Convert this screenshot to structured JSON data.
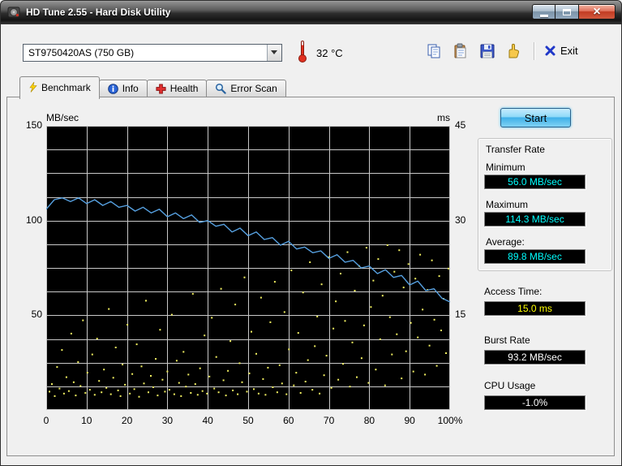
{
  "window": {
    "title": "HD Tune 2.55 - Hard Disk Utility",
    "controls": {
      "close_glyph": "×"
    }
  },
  "toolbar": {
    "drive": "ST9750420AS (750 GB)",
    "temperature": "32 °C",
    "exit_label": "Exit",
    "icons": [
      "copy-image",
      "copy-text",
      "save-screenshot",
      "options",
      "exit"
    ]
  },
  "tabs": [
    {
      "label": "Benchmark",
      "icon": "benchmark-icon",
      "active": true
    },
    {
      "label": "Info",
      "icon": "info-icon",
      "active": false
    },
    {
      "label": "Health",
      "icon": "health-icon",
      "active": false
    },
    {
      "label": "Error Scan",
      "icon": "error-scan-icon",
      "active": false
    }
  ],
  "side_panel": {
    "start_label": "Start",
    "transfer_rate": {
      "title": "Transfer Rate",
      "minimum_label": "Minimum",
      "minimum_value": "56.0 MB/sec",
      "maximum_label": "Maximum",
      "maximum_value": "114.3 MB/sec",
      "average_label": "Average:",
      "average_value": "89.8 MB/sec"
    },
    "access_time_label": "Access Time:",
    "access_time_value": "15.0 ms",
    "burst_rate_label": "Burst Rate",
    "burst_rate_value": "93.2 MB/sec",
    "cpu_usage_label": "CPU Usage",
    "cpu_usage_value": "-1.0%"
  },
  "colors": {
    "transfer_value_text": "#00ffff",
    "access_value_text": "#ffff00",
    "burst_value_text": "#ffffff",
    "cpu_value_text": "#ffffff",
    "chart_background": "#000000",
    "grid": "#c8c8c8",
    "transfer_line": "#56a0e0",
    "access_dots": "#f0ee60"
  },
  "chart_data": {
    "type": "line",
    "title": "",
    "left_axis": {
      "label": "MB/sec",
      "min": 0,
      "max": 150,
      "ticks": [
        150,
        100,
        50
      ]
    },
    "right_axis": {
      "label": "ms",
      "min": 0,
      "max": 45,
      "ticks": [
        45,
        30,
        15
      ]
    },
    "x_axis": {
      "min": 0,
      "max": 100,
      "tick_labels": [
        "0",
        "10",
        "20",
        "30",
        "40",
        "50",
        "60",
        "70",
        "80",
        "90",
        "100%"
      ]
    },
    "grid": {
      "x_divisions": 10,
      "y_divisions": 12,
      "color": "#c8c8c8"
    },
    "series": [
      {
        "name": "transfer_rate",
        "unit": "MB/sec",
        "color": "#56a0e0",
        "x_start": 0,
        "x_step": 2,
        "values": [
          106,
          111,
          112,
          110,
          112,
          109,
          111,
          108,
          110,
          107,
          108,
          105,
          107,
          104,
          106,
          102,
          104,
          101,
          103,
          99,
          100,
          97,
          98,
          94,
          96,
          92,
          94,
          90,
          91,
          87,
          89,
          85,
          86,
          83,
          84,
          80,
          82,
          78,
          79,
          75,
          76,
          72,
          74,
          70,
          71,
          66,
          68,
          63,
          64,
          59,
          57
        ]
      },
      {
        "name": "access_time_ms",
        "type": "scatter",
        "unit": "ms",
        "color": "#f0ee60",
        "points": [
          [
            0.8,
            2.9
          ],
          [
            1.4,
            4.1
          ],
          [
            2.1,
            2.2
          ],
          [
            2.7,
            6.8
          ],
          [
            3.3,
            3.4
          ],
          [
            3.9,
            9.5
          ],
          [
            4.4,
            2.6
          ],
          [
            5.0,
            5.2
          ],
          [
            5.6,
            3.0
          ],
          [
            6.2,
            12.1
          ],
          [
            6.8,
            4.4
          ],
          [
            7.3,
            2.3
          ],
          [
            7.9,
            7.6
          ],
          [
            8.5,
            3.8
          ],
          [
            9.1,
            14.2
          ],
          [
            9.7,
            2.7
          ],
          [
            10.2,
            5.9
          ],
          [
            10.8,
            3.2
          ],
          [
            11.4,
            8.8
          ],
          [
            12.0,
            2.4
          ],
          [
            12.6,
            11.3
          ],
          [
            13.1,
            4.6
          ],
          [
            13.7,
            2.8
          ],
          [
            14.3,
            6.4
          ],
          [
            14.9,
            3.5
          ],
          [
            15.5,
            16.0
          ],
          [
            16.0,
            2.5
          ],
          [
            16.6,
            5.1
          ],
          [
            17.2,
            9.9
          ],
          [
            17.8,
            3.1
          ],
          [
            18.4,
            2.2
          ],
          [
            18.9,
            7.2
          ],
          [
            19.5,
            4.0
          ],
          [
            20.1,
            13.5
          ],
          [
            20.7,
            2.6
          ],
          [
            21.3,
            5.7
          ],
          [
            21.8,
            3.3
          ],
          [
            22.4,
            10.4
          ],
          [
            23.0,
            2.1
          ],
          [
            23.6,
            6.9
          ],
          [
            24.2,
            4.2
          ],
          [
            24.7,
            17.3
          ],
          [
            25.3,
            2.8
          ],
          [
            25.9,
            5.4
          ],
          [
            26.5,
            3.6
          ],
          [
            27.1,
            8.1
          ],
          [
            27.6,
            2.3
          ],
          [
            28.2,
            12.7
          ],
          [
            28.8,
            4.8
          ],
          [
            29.4,
            2.9
          ],
          [
            30.0,
            6.1
          ],
          [
            30.5,
            3.2
          ],
          [
            31.1,
            15.1
          ],
          [
            31.7,
            2.5
          ],
          [
            32.3,
            7.8
          ],
          [
            32.9,
            4.3
          ],
          [
            33.4,
            2.2
          ],
          [
            34.0,
            9.2
          ],
          [
            34.6,
            3.7
          ],
          [
            35.2,
            5.6
          ],
          [
            35.8,
            2.7
          ],
          [
            36.3,
            18.4
          ],
          [
            36.9,
            4.1
          ],
          [
            37.5,
            2.4
          ],
          [
            38.1,
            6.6
          ],
          [
            38.7,
            3.0
          ],
          [
            39.2,
            11.8
          ],
          [
            39.8,
            2.6
          ],
          [
            40.4,
            5.3
          ],
          [
            41.0,
            14.6
          ],
          [
            41.6,
            3.4
          ],
          [
            42.1,
            8.4
          ],
          [
            42.7,
            2.8
          ],
          [
            43.3,
            19.2
          ],
          [
            43.9,
            4.7
          ],
          [
            44.5,
            2.3
          ],
          [
            45.0,
            6.2
          ],
          [
            45.6,
            10.9
          ],
          [
            46.2,
            3.1
          ],
          [
            46.8,
            16.7
          ],
          [
            47.4,
            2.5
          ],
          [
            47.9,
            7.4
          ],
          [
            48.5,
            4.4
          ],
          [
            49.1,
            21.0
          ],
          [
            49.7,
            2.9
          ],
          [
            50.3,
            5.8
          ],
          [
            50.8,
            12.4
          ],
          [
            51.4,
            3.3
          ],
          [
            52.0,
            8.9
          ],
          [
            52.6,
            2.6
          ],
          [
            53.2,
            17.8
          ],
          [
            53.7,
            4.9
          ],
          [
            54.3,
            2.4
          ],
          [
            54.9,
            6.7
          ],
          [
            55.5,
            13.9
          ],
          [
            56.1,
            3.6
          ],
          [
            56.6,
            20.3
          ],
          [
            57.2,
            2.8
          ],
          [
            57.8,
            7.1
          ],
          [
            58.4,
            4.2
          ],
          [
            59.0,
            15.5
          ],
          [
            59.5,
            2.5
          ],
          [
            60.1,
            9.6
          ],
          [
            60.7,
            22.1
          ],
          [
            61.3,
            3.9
          ],
          [
            61.9,
            5.9
          ],
          [
            62.4,
            12.2
          ],
          [
            63.0,
            2.7
          ],
          [
            63.6,
            18.6
          ],
          [
            64.2,
            4.5
          ],
          [
            64.8,
            7.9
          ],
          [
            65.3,
            23.4
          ],
          [
            65.9,
            3.2
          ],
          [
            66.5,
            10.1
          ],
          [
            67.1,
            14.8
          ],
          [
            67.7,
            2.6
          ],
          [
            68.2,
            19.9
          ],
          [
            68.8,
            5.5
          ],
          [
            69.4,
            8.6
          ],
          [
            70.0,
            24.2
          ],
          [
            70.6,
            3.5
          ],
          [
            71.1,
            12.9
          ],
          [
            71.7,
            17.2
          ],
          [
            72.3,
            4.8
          ],
          [
            72.9,
            21.6
          ],
          [
            73.5,
            7.3
          ],
          [
            74.0,
            14.1
          ],
          [
            74.6,
            25.0
          ],
          [
            75.2,
            3.7
          ],
          [
            75.8,
            10.7
          ],
          [
            76.4,
            18.9
          ],
          [
            76.9,
            5.2
          ],
          [
            77.5,
            22.8
          ],
          [
            78.1,
            8.2
          ],
          [
            78.7,
            13.4
          ],
          [
            79.3,
            25.7
          ],
          [
            79.8,
            4.3
          ],
          [
            80.4,
            16.3
          ],
          [
            81.0,
            20.5
          ],
          [
            81.6,
            6.4
          ],
          [
            82.2,
            23.9
          ],
          [
            82.7,
            11.2
          ],
          [
            83.3,
            18.1
          ],
          [
            83.9,
            3.9
          ],
          [
            84.5,
            26.1
          ],
          [
            85.1,
            14.7
          ],
          [
            85.6,
            8.8
          ],
          [
            86.2,
            21.9
          ],
          [
            86.8,
            12.0
          ],
          [
            87.4,
            25.3
          ],
          [
            88.0,
            5.0
          ],
          [
            88.5,
            19.4
          ],
          [
            89.1,
            9.3
          ],
          [
            89.7,
            23.1
          ],
          [
            90.3,
            13.8
          ],
          [
            90.9,
            6.1
          ],
          [
            91.4,
            20.8
          ],
          [
            92.0,
            11.5
          ],
          [
            92.6,
            24.6
          ],
          [
            93.2,
            15.9
          ],
          [
            93.8,
            5.6
          ],
          [
            94.4,
            19.0
          ],
          [
            94.9,
            10.2
          ],
          [
            95.5,
            23.7
          ],
          [
            96.1,
            14.3
          ],
          [
            96.7,
            7.0
          ],
          [
            97.3,
            21.2
          ],
          [
            97.8,
            12.6
          ],
          [
            98.4,
            17.6
          ],
          [
            99.0,
            9.0
          ],
          [
            99.6,
            22.4
          ]
        ]
      }
    ]
  }
}
